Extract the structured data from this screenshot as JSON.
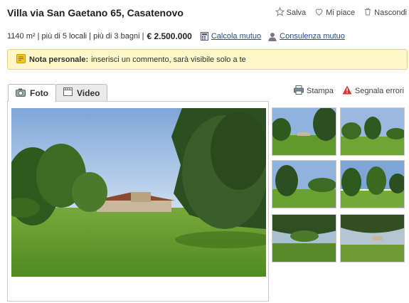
{
  "listing": {
    "title": "Villa via San Gaetano 65, Casatenovo",
    "actions": {
      "save": "Salva",
      "like": "Mi piace",
      "hide": "Nascondi"
    },
    "details": "1140 m² | più di 5 locali | più di 3 bagni |",
    "price": "€ 2.500.000",
    "mortgage_link": "Calcola mutuo",
    "consult_link": "Consulenza mutuo"
  },
  "note": {
    "label": "Nota personale:",
    "text": "inserisci un commento, sarà visibile solo a te"
  },
  "tabs": {
    "photo": "Foto",
    "video": "Video"
  },
  "tools": {
    "print": "Stampa",
    "report": "Segnala errori"
  },
  "colors": {
    "note_bg": "#fdf6c9",
    "link": "#2a4b8d",
    "report_icon": "#d33"
  },
  "icons": [
    "star-icon",
    "heart-icon",
    "trash-icon",
    "calculator-icon",
    "person-icon",
    "note-icon",
    "camera-icon",
    "film-icon",
    "printer-icon",
    "warning-icon"
  ]
}
